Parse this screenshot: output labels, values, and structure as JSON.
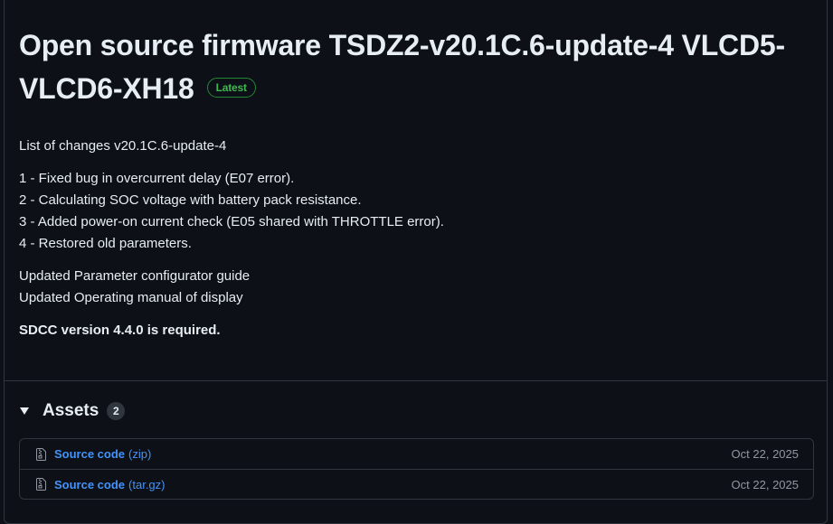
{
  "release": {
    "title": "Open source firmware TSDZ2-v20.1C.6-update-4 VLCD5-VLCD6-XH18",
    "badge": "Latest"
  },
  "notes": {
    "heading": "List of changes v20.1C.6-update-4",
    "changes": [
      "1 - Fixed bug in overcurrent delay (E07 error).",
      "2 - Calculating SOC voltage with battery pack resistance.",
      "3 - Added power-on current check (E05 shared with THROTTLE error).",
      "4 - Restored old parameters."
    ],
    "updates": [
      "Updated Parameter configurator guide",
      "Updated Operating manual of display"
    ],
    "requirement": "SDCC version 4.4.0 is required."
  },
  "assets": {
    "title": "Assets",
    "count": "2",
    "items": [
      {
        "name": "Source code",
        "ext": "(zip)",
        "date": "Oct 22, 2025",
        "icon": "file-zip-icon"
      },
      {
        "name": "Source code",
        "ext": "(tar.gz)",
        "date": "Oct 22, 2025",
        "icon": "file-zip-icon"
      }
    ]
  },
  "colors": {
    "background": "#0d1117",
    "text": "#e6edf3",
    "link": "#4493f8",
    "muted": "#9198a1",
    "border": "#30363d",
    "latest": "#3fb950"
  }
}
